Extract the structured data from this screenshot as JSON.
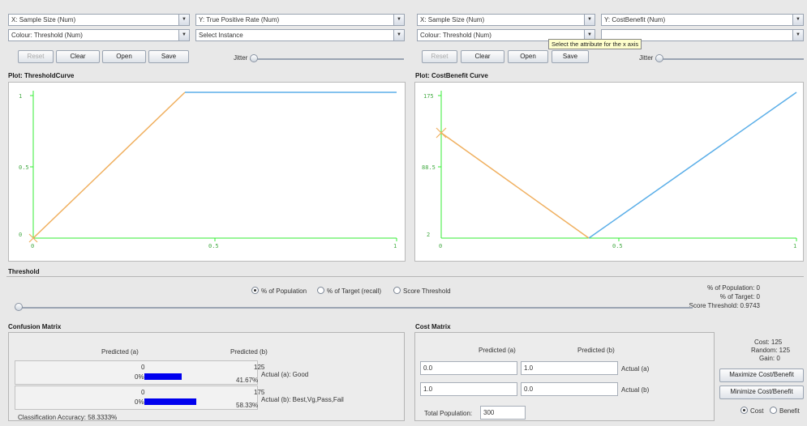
{
  "left": {
    "x_axis": "X: Sample Size (Num)",
    "y_axis": "Y: True Positive Rate (Num)",
    "colour": "Colour: Threshold (Num)",
    "instance": "Select Instance",
    "reset": "Reset",
    "clear": "Clear",
    "open": "Open",
    "save": "Save",
    "jitter": "Jitter",
    "plot_title": "Plot: ThresholdCurve",
    "y_ticks": [
      "1",
      "0.5",
      "0"
    ],
    "x_ticks": [
      "0",
      "0.5",
      "1"
    ]
  },
  "right": {
    "x_axis": "X: Sample Size (Num)",
    "y_axis": "Y: CostBenefit (Num)",
    "colour": "Colour: Threshold (Num)",
    "reset": "Reset",
    "clear": "Clear",
    "open": "Open",
    "save": "Save",
    "jitter": "Jitter",
    "tooltip": "Select the attribute for the x axis",
    "plot_title": "Plot: CostBenefit Curve",
    "y_ticks": [
      "175",
      "88.5",
      "2"
    ],
    "x_ticks": [
      "0",
      "0.5",
      "1"
    ]
  },
  "threshold": {
    "title": "Threshold",
    "opt_population": "% of Population",
    "opt_target": "% of Target (recall)",
    "opt_score": "Score Threshold",
    "pct_population": "% of Population: 0",
    "pct_target": "% of Target: 0",
    "score_threshold": "Score Threshold: 0.9743",
    "slider_level": 0
  },
  "confusion": {
    "title": "Confusion Matrix",
    "col_a": "Predicted (a)",
    "col_b": "Predicted (b)",
    "rows": [
      {
        "a_count": "0",
        "a_pct": "0%",
        "b_count": "125",
        "b_pct": "41.67%",
        "label": "Actual (a): Good",
        "bar_fraction": 0.4167
      },
      {
        "a_count": "0",
        "a_pct": "0%",
        "b_count": "175",
        "b_pct": "58.33%",
        "label": "Actual (b): Best,Vg,Pass,Fail",
        "bar_fraction": 0.5833
      }
    ],
    "accuracy": "Classification Accuracy:  58.3333%"
  },
  "cost": {
    "title": "Cost Matrix",
    "col_a": "Predicted (a)",
    "col_b": "Predicted (b)",
    "row_a": [
      "0.0",
      "1.0"
    ],
    "row_b": [
      "1.0",
      "0.0"
    ],
    "label_a": "Actual (a)",
    "label_b": "Actual (b)",
    "total_label": "Total Population:",
    "total_value": "300",
    "cost_text": "Cost: 125",
    "random_text": "Random: 125",
    "gain_text": "Gain: 0",
    "maximize": "Maximize Cost/Benefit",
    "minimize": "Minimize Cost/Benefit",
    "opt_cost": "Cost",
    "opt_benefit": "Benefit"
  },
  "colors": {
    "axis": "#33ee33",
    "curve_low": "#f0b060",
    "curve_high": "#5aaee8",
    "bar": "#0000ee"
  }
}
